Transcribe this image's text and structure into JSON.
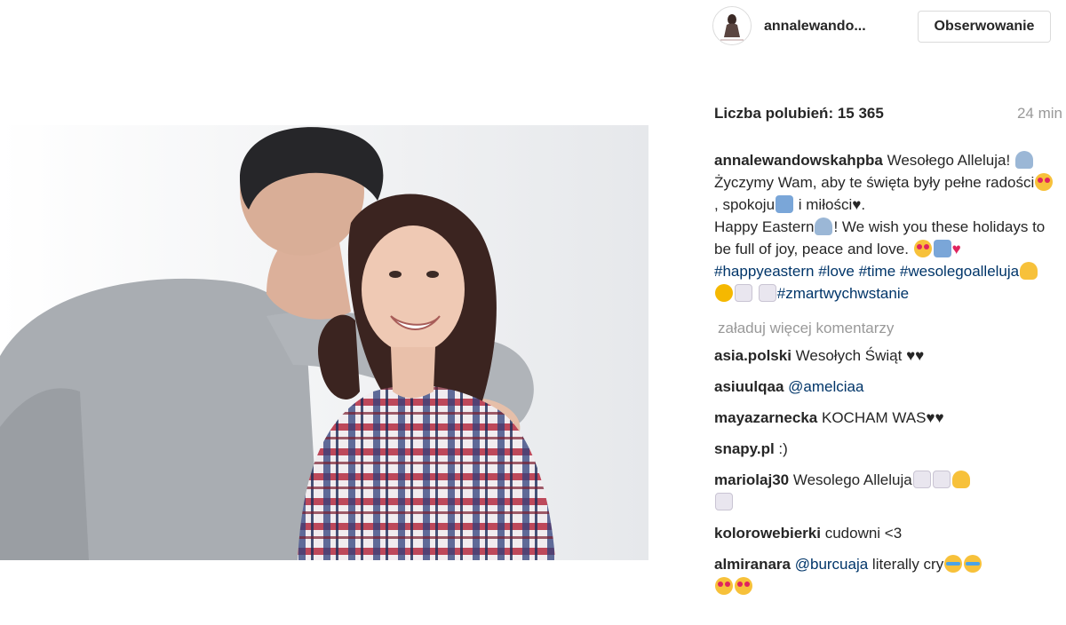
{
  "post": {
    "username": "annalewando...",
    "follow_label": "Obserwowanie",
    "likes_label": "Liczba polubień: 15 365",
    "time": "24 min"
  },
  "caption": {
    "username": "annalewandowskahpba",
    "text_1": " Wesołego Alleluja! ",
    "text_2": " Życzymy Wam, aby te święta były pełne radości",
    "text_3": ", spokoju",
    "text_4": " i miłości",
    "heart_1": "♥",
    "text_5": ".",
    "text_6": "Happy Eastern",
    "text_7": "! We wish you these holidays to be full of joy, peace and love. ",
    "heart_red": "♥",
    "tags": [
      "#happyeastern",
      "#love",
      "#time",
      "#wesolegoalleluja",
      "#zmartwychwstanie"
    ]
  },
  "load_more_label": "załaduj więcej komentarzy",
  "comments": [
    {
      "user": "asia.polski",
      "text": " Wesołych Świąt ",
      "hearts": "♥♥"
    },
    {
      "user": "asiuulqaa",
      "mention": "@amelciaa"
    },
    {
      "user": "mayazarnecka",
      "text": " KOCHAM WAS",
      "hearts": "♥♥"
    },
    {
      "user": "snapy.pl",
      "text": " :)"
    },
    {
      "user": "mariolaj30",
      "text": " Wesolego Alleluja"
    },
    {
      "user": "kolorowebierki",
      "text": " cudowni <3"
    },
    {
      "user": "almiranara",
      "mention": "@burcuaja",
      "text": " literally cry"
    }
  ],
  "icons": {
    "emoji_person": "person-icon",
    "emoji_heart_eyes": "heart-eyes-icon",
    "emoji_pray": "pray-icon",
    "emoji_hatch": "hatching-chick-icon",
    "emoji_chick": "chick-icon",
    "emoji_bunny": "bunny-icon",
    "emoji_tear": "tears-of-joy-icon"
  },
  "colors": {
    "link": "#003569",
    "muted": "#999999",
    "text": "#262626",
    "border": "#dbdbdb"
  }
}
